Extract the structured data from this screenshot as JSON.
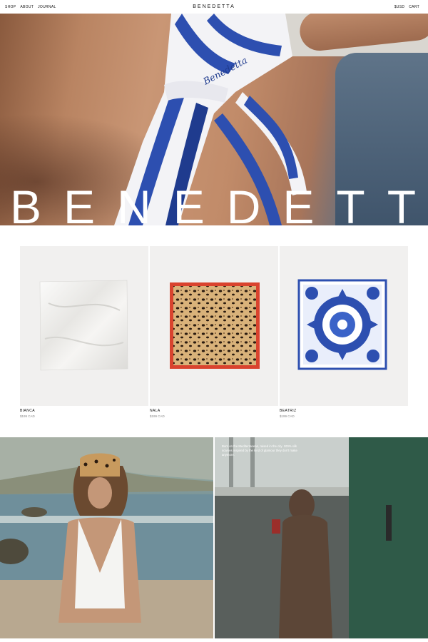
{
  "nav": {
    "left_links": [
      "SHOP",
      "ABOUT",
      "JOURNAL"
    ],
    "logo": "BENEDETTA",
    "right_links": [
      "$USD",
      "CART"
    ]
  },
  "hero": {
    "wordmark": "BENEDETTA",
    "scarf_print_text": "Benedetta"
  },
  "products": [
    {
      "name": "BIANCA",
      "price": "$199 CAD"
    },
    {
      "name": "NALA",
      "price": "$199 CAD"
    },
    {
      "name": "BEATRIZ",
      "price": "$199 CAD"
    }
  ],
  "editorial": {
    "caption": "Born on the Mediterranean, raised in the city. 100% silk scarves inspired by the kind of glamour they don't make anymore."
  },
  "colors": {
    "accent_blue": "#2d4fb0",
    "leopard_border": "#d9432e",
    "nav_text": "#111111"
  }
}
